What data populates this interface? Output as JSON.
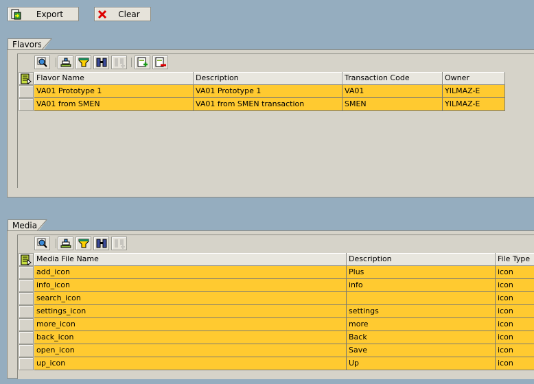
{
  "toolbar": {
    "export_label": "Export",
    "clear_label": "Clear"
  },
  "flavors": {
    "tab": "Flavors",
    "columns": [
      "Flavor Name",
      "Description",
      "Transaction Code",
      "Owner"
    ],
    "rows": [
      [
        "VA01 Prototype 1",
        "VA01 Prototype 1",
        "VA01",
        "YILMAZ-E"
      ],
      [
        "VA01 from SMEN",
        "VA01 from SMEN transaction",
        "SMEN",
        "YILMAZ-E"
      ]
    ]
  },
  "media": {
    "tab": "Media",
    "columns": [
      "Media File Name",
      "Description",
      "File Type"
    ],
    "rows": [
      [
        "add_icon",
        "Plus",
        "icon"
      ],
      [
        "info_icon",
        "info",
        "icon"
      ],
      [
        "search_icon",
        "",
        "icon"
      ],
      [
        "settings_icon",
        "settings",
        "icon"
      ],
      [
        "more_icon",
        "more",
        "icon"
      ],
      [
        "back_icon",
        "Back",
        "icon"
      ],
      [
        "open_icon",
        "Save",
        "icon"
      ],
      [
        "up_icon",
        "Up",
        "icon"
      ]
    ]
  },
  "colors": {
    "row": "#ffca30",
    "panel": "#d6d3c9",
    "background": "#95adbf"
  }
}
